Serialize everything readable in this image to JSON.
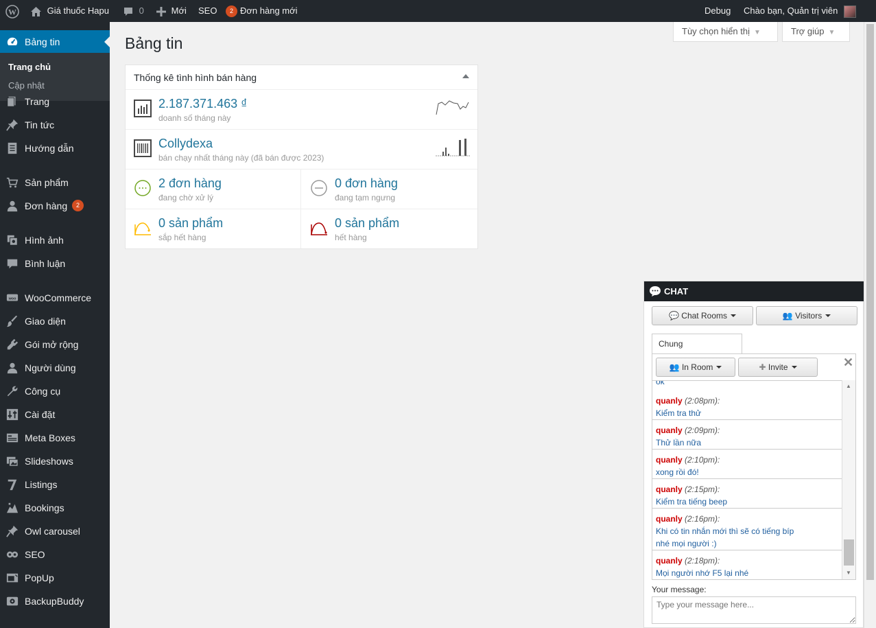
{
  "adminbar": {
    "site_name": "Giá thuốc Hapu",
    "comments_count": "0",
    "new_label": "Mới",
    "seo_label": "SEO",
    "orders_badge": "2",
    "orders_label": "Đơn hàng mới",
    "debug_label": "Debug",
    "greeting": "Chào bạn, Quản trị viên"
  },
  "sidebar": {
    "dashboard": "Bảng tin",
    "sub_home": "Trang chủ",
    "sub_updates": "Cập nhật",
    "items": [
      {
        "label": "Trang",
        "icon": "pages-icon"
      },
      {
        "label": "Tin tức",
        "icon": "pin-icon"
      },
      {
        "label": "Hướng dẫn",
        "icon": "document-icon"
      },
      {
        "label": "Sản phẩm",
        "icon": "cart-icon"
      },
      {
        "label": "Đơn hàng",
        "icon": "user-icon",
        "badge": "2"
      },
      {
        "label": "Hình ảnh",
        "icon": "media-icon"
      },
      {
        "label": "Bình luận",
        "icon": "comment-icon"
      },
      {
        "label": "WooCommerce",
        "icon": "woo-icon"
      },
      {
        "label": "Giao diện",
        "icon": "brush-icon"
      },
      {
        "label": "Gói mở rộng",
        "icon": "plugin-icon"
      },
      {
        "label": "Người dùng",
        "icon": "users-icon"
      },
      {
        "label": "Công cụ",
        "icon": "wrench-icon"
      },
      {
        "label": "Cài đặt",
        "icon": "settings-icon"
      },
      {
        "label": "Meta Boxes",
        "icon": "metabox-icon"
      },
      {
        "label": "Slideshows",
        "icon": "slides-icon"
      },
      {
        "label": "Listings",
        "icon": "listing-icon"
      },
      {
        "label": "Bookings",
        "icon": "bookings-icon"
      },
      {
        "label": "Owl carousel",
        "icon": "pin-icon"
      },
      {
        "label": "SEO",
        "icon": "seo-icon"
      },
      {
        "label": "PopUp",
        "icon": "popup-icon"
      },
      {
        "label": "BackupBuddy",
        "icon": "backup-icon"
      }
    ]
  },
  "main": {
    "title": "Bảng tin",
    "screen_options": "Tùy chọn hiển thị",
    "help": "Trợ giúp"
  },
  "widget": {
    "title": "Thống kê tình hình bán hàng",
    "sales_value": "2.187.371.463 ₫",
    "sales_label": "doanh số tháng này",
    "top_seller": "Collydexa",
    "top_seller_label": "bán chạy nhất tháng này (đã bán được 2023)",
    "processing_value": "2 đơn hàng",
    "processing_label": "đang chờ xử lý",
    "onhold_value": "0 đơn hàng",
    "onhold_label": "đang tạm ngưng",
    "lowstock_value": "0 sản phẩm",
    "lowstock_label": "sắp hết hàng",
    "outstock_value": "0 sản phẩm",
    "outstock_label": "hết hàng"
  },
  "chat": {
    "title": "CHAT",
    "rooms_btn": "Chat Rooms",
    "visitors_btn": "Visitors",
    "tab": "Chung",
    "inroom_btn": "In Room",
    "invite_btn": "Invite",
    "partial_msg": "ok",
    "messages": [
      {
        "user": "quanly",
        "time": "(2:08pm)",
        "lines": [
          "Kiểm tra thử"
        ]
      },
      {
        "user": "quanly",
        "time": "(2:09pm)",
        "lines": [
          "Thử lần nữa"
        ]
      },
      {
        "user": "quanly",
        "time": "(2:10pm)",
        "lines": [
          "xong rồi đó!"
        ]
      },
      {
        "user": "quanly",
        "time": "(2:15pm)",
        "lines": [
          "Kiểm tra tiếng beep"
        ]
      },
      {
        "user": "quanly",
        "time": "(2:16pm)",
        "lines": [
          "Khi có tin nhắn mới thì sẽ có tiếng bíp",
          "nhé mọi người :)"
        ]
      },
      {
        "user": "quanly",
        "time": "(2:18pm)",
        "lines": [
          "Mọi người nhớ F5 lại nhé"
        ]
      }
    ],
    "message_label": "Your message:",
    "message_placeholder": "Type your message here..."
  },
  "colors": {
    "adminbar_bg": "#23282d",
    "accent": "#0073aa",
    "link": "#21759b",
    "badge": "#d54e21",
    "chat_user": "#cc0000"
  }
}
